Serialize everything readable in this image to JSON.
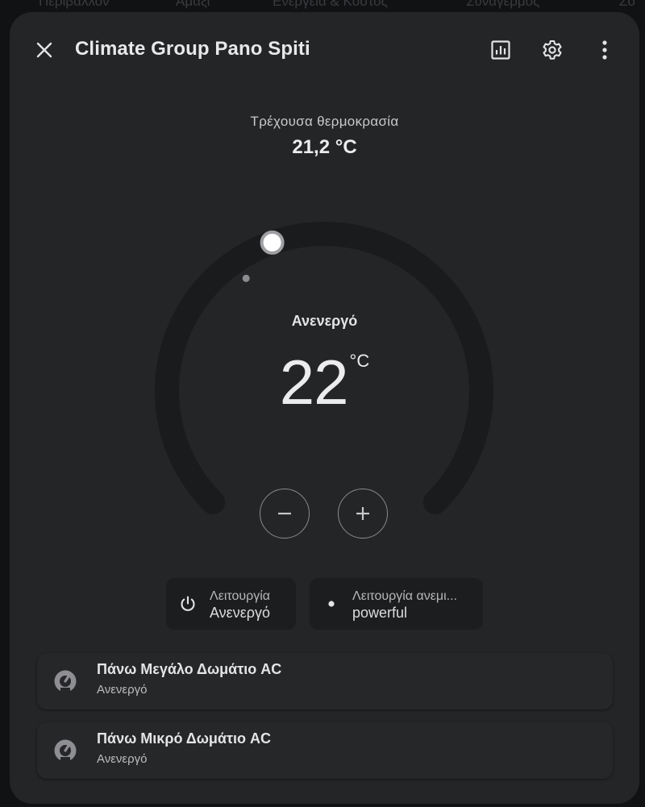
{
  "background": {
    "tabs": [
      "Περιβάλλον",
      "Αμάξι",
      "Ενέργεια & Κόστος",
      "Συναγερμός",
      "Zo"
    ]
  },
  "dialog": {
    "title": "Climate Group Pano Spiti",
    "header_icons": [
      "history-chart-icon",
      "gear-icon",
      "more-vertical-icon"
    ]
  },
  "current": {
    "label": "Τρέχουσα θερμοκρασία",
    "value": "21,2 °C"
  },
  "thermostat": {
    "state": "Ανενεργό",
    "target": "22",
    "unit": "°C",
    "min": 16,
    "max": 30,
    "current_temp": 21.2,
    "target_temp": 22,
    "colors": {
      "track": "#1a1b1d",
      "handle": "#ffffff",
      "handle_ring": "#9e9ea3",
      "current_dot": "#8d8d91"
    }
  },
  "buttons": {
    "decrease": "−",
    "increase": "+"
  },
  "chips": [
    {
      "label": "Λειτουργία",
      "value": "Ανενεργό",
      "icon": "power-icon"
    },
    {
      "label": "Λειτουργία ανεμι...",
      "value": "powerful",
      "icon": "dot-icon"
    }
  ],
  "entities": [
    {
      "name": "Πάνω Μεγάλο Δωμάτιο AC",
      "state": "Ανενεργό",
      "icon": "thermostat-icon"
    },
    {
      "name": "Πάνω Μικρό Δωμάτιο AC",
      "state": "Ανενεργό",
      "icon": "thermostat-icon"
    }
  ]
}
